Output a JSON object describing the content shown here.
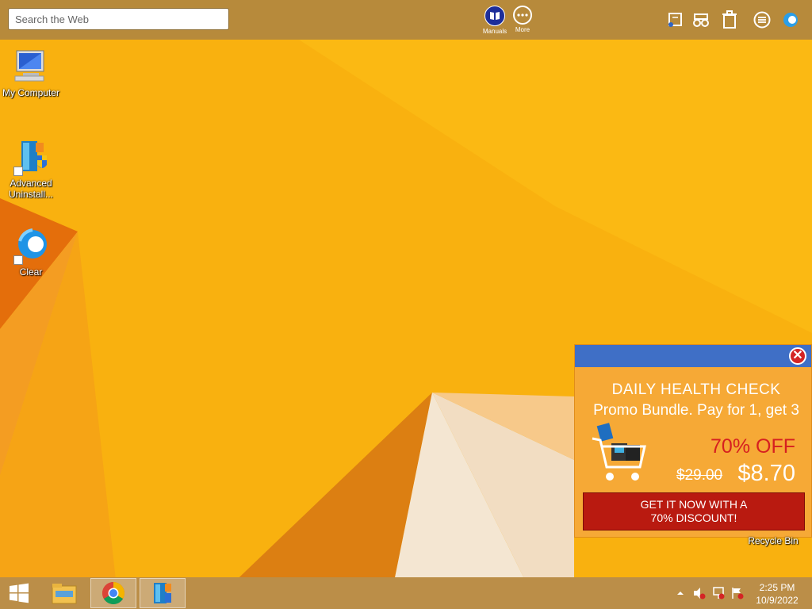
{
  "toolbar": {
    "search_placeholder": "Search the Web",
    "manuals_label": "Manuals",
    "more_label": "More",
    "icons": [
      "news-icon",
      "binoculars-icon",
      "trash-icon",
      "menu-icon",
      "clear-logo-icon"
    ]
  },
  "desktop": {
    "icons": [
      {
        "label": "My Computer",
        "icon": "computer-icon"
      },
      {
        "label": "Advanced Uninstall...",
        "icon": "advanced-uninstaller-icon"
      },
      {
        "label": "Clear",
        "icon": "clear-icon"
      }
    ],
    "recycle_bin_label": "Recycle Bin"
  },
  "popup": {
    "title": "DAILY HEALTH CHECK",
    "subtitle": "Promo Bundle. Pay for 1, get 3",
    "discount": "70% OFF",
    "old_price": "$29.00",
    "new_price": "$8.70",
    "cta_line1": "GET IT NOW WITH A",
    "cta_line2": "70% DISCOUNT!",
    "header_color": "#3f6fc6",
    "cta_color": "#b91a10"
  },
  "taskbar": {
    "items": [
      "start-button",
      "file-explorer",
      "chrome",
      "advanced-uninstaller"
    ],
    "time": "2:25 PM",
    "date": "10/9/2022"
  },
  "colors": {
    "wallpaper": "#f7ab0c",
    "toolbar": "#b78a3b",
    "taskbar": "#bb8e48"
  }
}
